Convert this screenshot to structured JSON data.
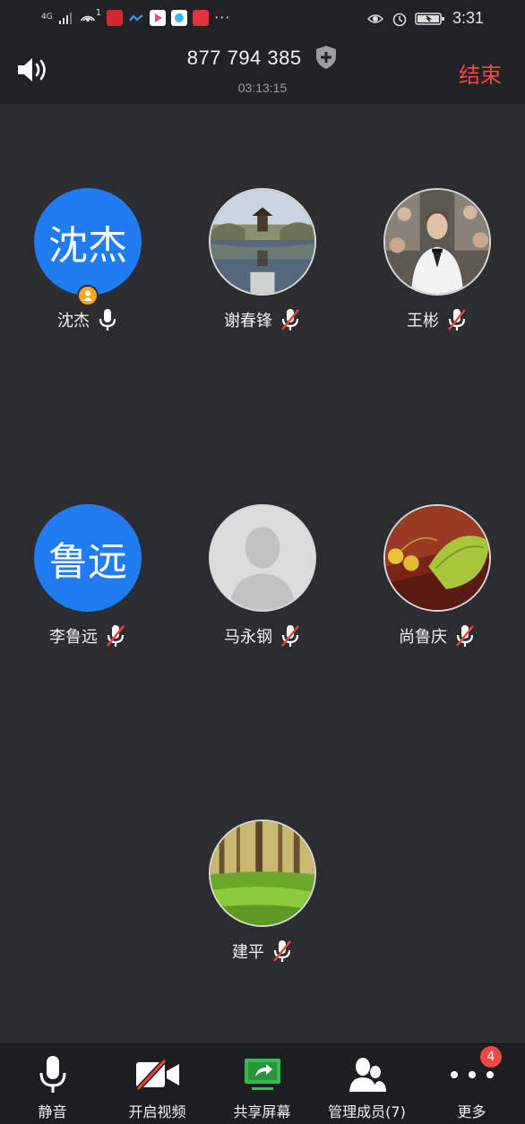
{
  "status_bar": {
    "network": "4G",
    "sim_indicator": "1",
    "time": "3:31",
    "more": "···"
  },
  "meeting": {
    "id": "877 794 385",
    "duration": "03:13:15",
    "end_label": "结束"
  },
  "participants": [
    {
      "name": "沈杰",
      "avatar_text": "沈杰",
      "avatar_type": "text",
      "is_host": true,
      "mic": "on"
    },
    {
      "name": "谢春锋",
      "avatar_type": "photo-pavilion",
      "mic": "muted"
    },
    {
      "name": "王彬",
      "avatar_type": "photo-person",
      "mic": "muted"
    },
    {
      "name": "李鲁远",
      "avatar_text": "鲁远",
      "avatar_type": "text",
      "mic": "muted"
    },
    {
      "name": "马永钢",
      "avatar_type": "default-silhouette",
      "mic": "muted"
    },
    {
      "name": "尚鲁庆",
      "avatar_type": "photo-ginkgo",
      "mic": "muted"
    },
    {
      "name": "建平",
      "avatar_type": "photo-forest",
      "mic": "muted"
    }
  ],
  "toolbar": {
    "mute_label": "静音",
    "video_label": "开启视频",
    "share_label": "共享屏幕",
    "members_label": "管理成员(7)",
    "more_label": "更多",
    "more_badge": "4"
  },
  "colors": {
    "background": "#2b2d30",
    "bar": "#212225",
    "accent_blue": "#1f7cf2",
    "end_red": "#f2473f",
    "share_green": "#2fbf4a",
    "video_red": "#e8433a",
    "host_badge": "#f5a623"
  }
}
